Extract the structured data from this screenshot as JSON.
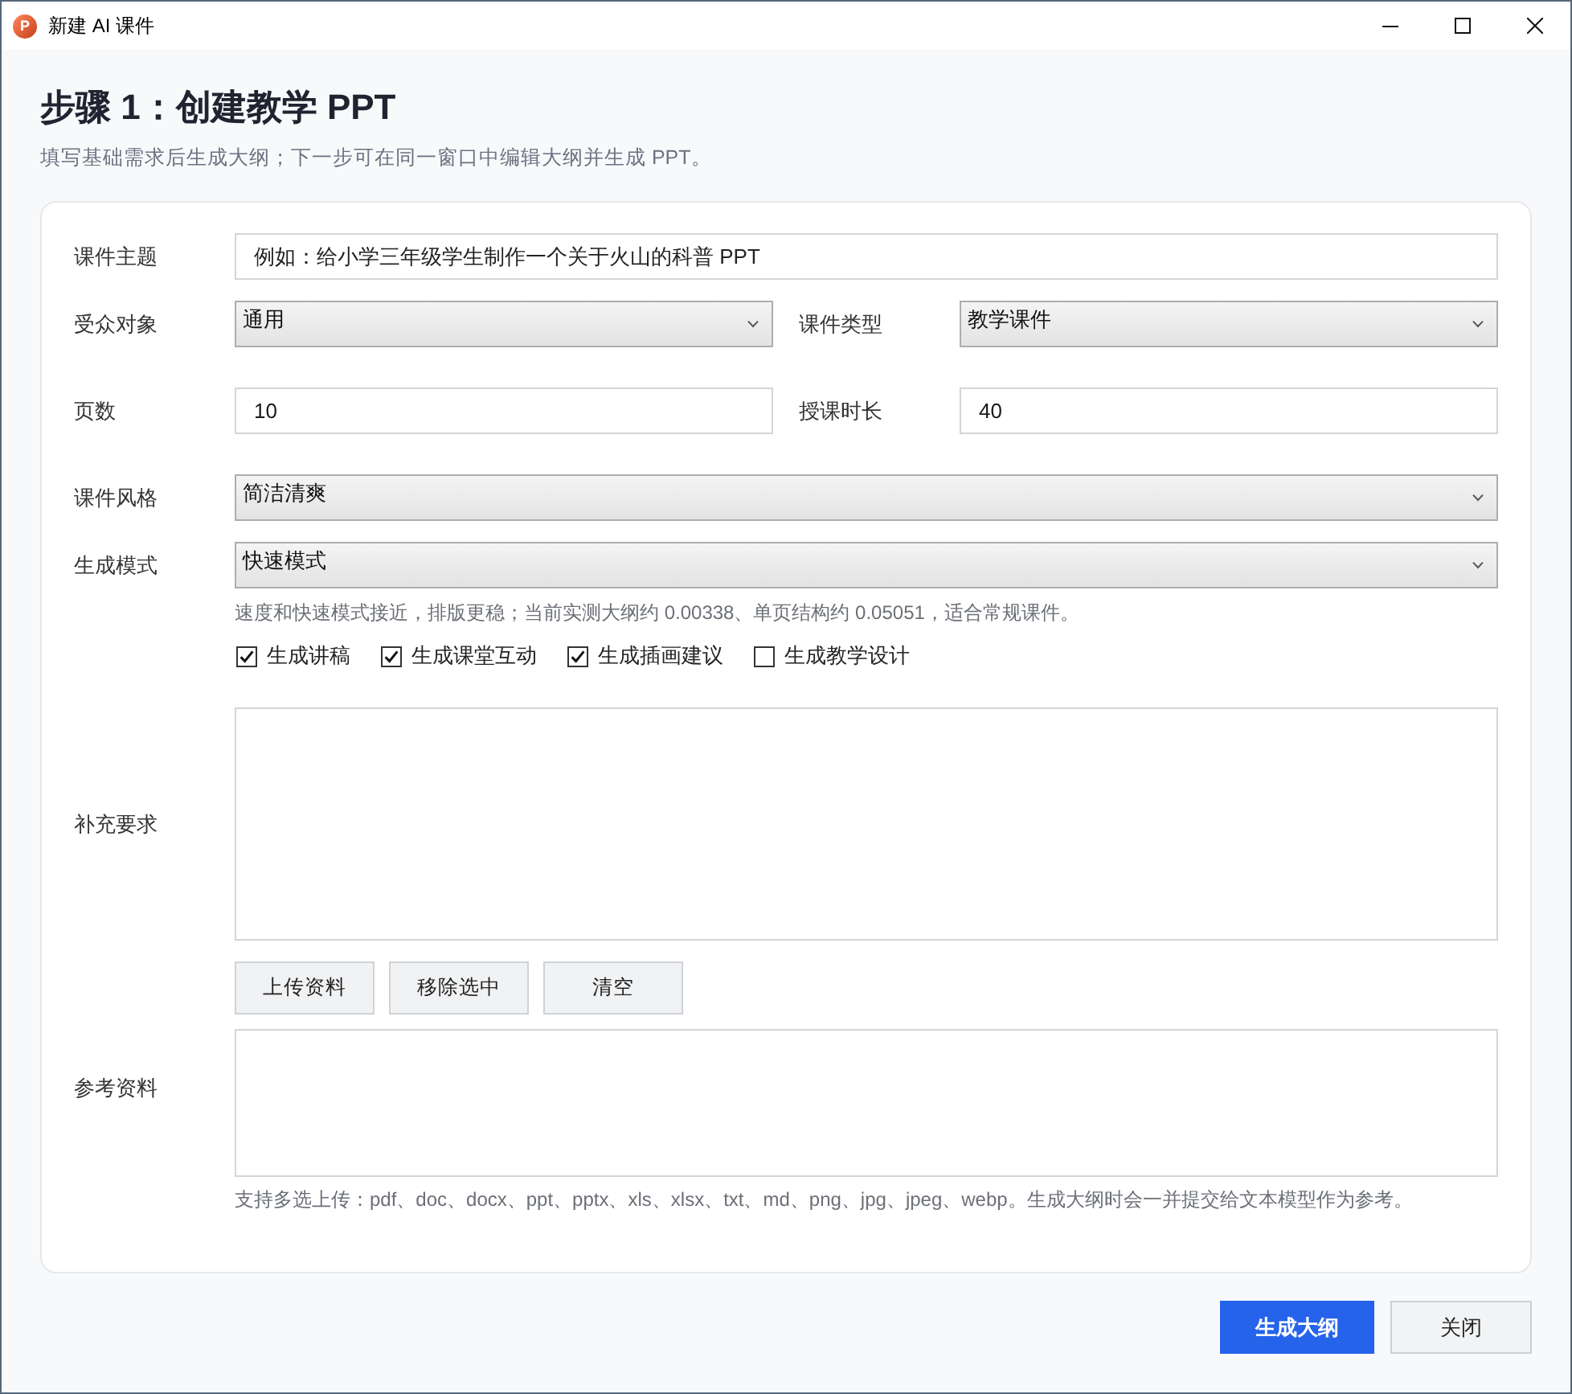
{
  "window": {
    "icon_letter": "P",
    "title": "新建 AI 课件"
  },
  "header": {
    "title": "步骤 1：创建教学 PPT",
    "subtitle": "填写基础需求后生成大纲；下一步可在同一窗口中编辑大纲并生成 PPT。"
  },
  "form": {
    "rows": [
      {
        "fields": [
          {
            "label": "课件主题",
            "kind": "input",
            "placeholder": "例如：给小学三年级学生制作一个关于火山的科普 PPT"
          }
        ]
      },
      {
        "fields": [
          {
            "label": "受众对象",
            "kind": "select",
            "value": "通用"
          },
          {
            "label": "课件类型",
            "kind": "select",
            "value": "教学课件"
          }
        ]
      },
      {
        "fields": [
          {
            "label": "页数",
            "kind": "input",
            "value": "10"
          },
          {
            "label": "授课时长",
            "kind": "input",
            "value": "40"
          }
        ]
      },
      {
        "fields": [
          {
            "label": "课件风格",
            "kind": "select",
            "value": "简洁清爽"
          }
        ]
      },
      {
        "fields": [
          {
            "label": "生成模式",
            "kind": "select",
            "value": "快速模式"
          }
        ]
      }
    ],
    "mode_hint": "速度和快速模式接近，排版更稳；当前实测大纲约 0.00338、单页结构约 0.05051，适合常规课件。",
    "options": [
      {
        "label": "生成讲稿",
        "checked": true
      },
      {
        "label": "生成课堂互动",
        "checked": true
      },
      {
        "label": "生成插画建议",
        "checked": true
      },
      {
        "label": "生成教学设计",
        "checked": false
      }
    ],
    "requirements": {
      "label": "补充要求"
    },
    "reference": {
      "buttons": [
        "上传资料",
        "移除选中",
        "清空"
      ],
      "label": "参考资料",
      "hint": "支持多选上传：pdf、doc、docx、ppt、pptx、xls、xlsx、txt、md、png、jpg、jpeg、webp。生成大纲时会一并提交给文本模型作为参考。"
    }
  },
  "footer": {
    "buttons": [
      {
        "label": "生成大纲",
        "kind": "primary"
      },
      {
        "label": "关闭",
        "kind": "default"
      }
    ]
  }
}
